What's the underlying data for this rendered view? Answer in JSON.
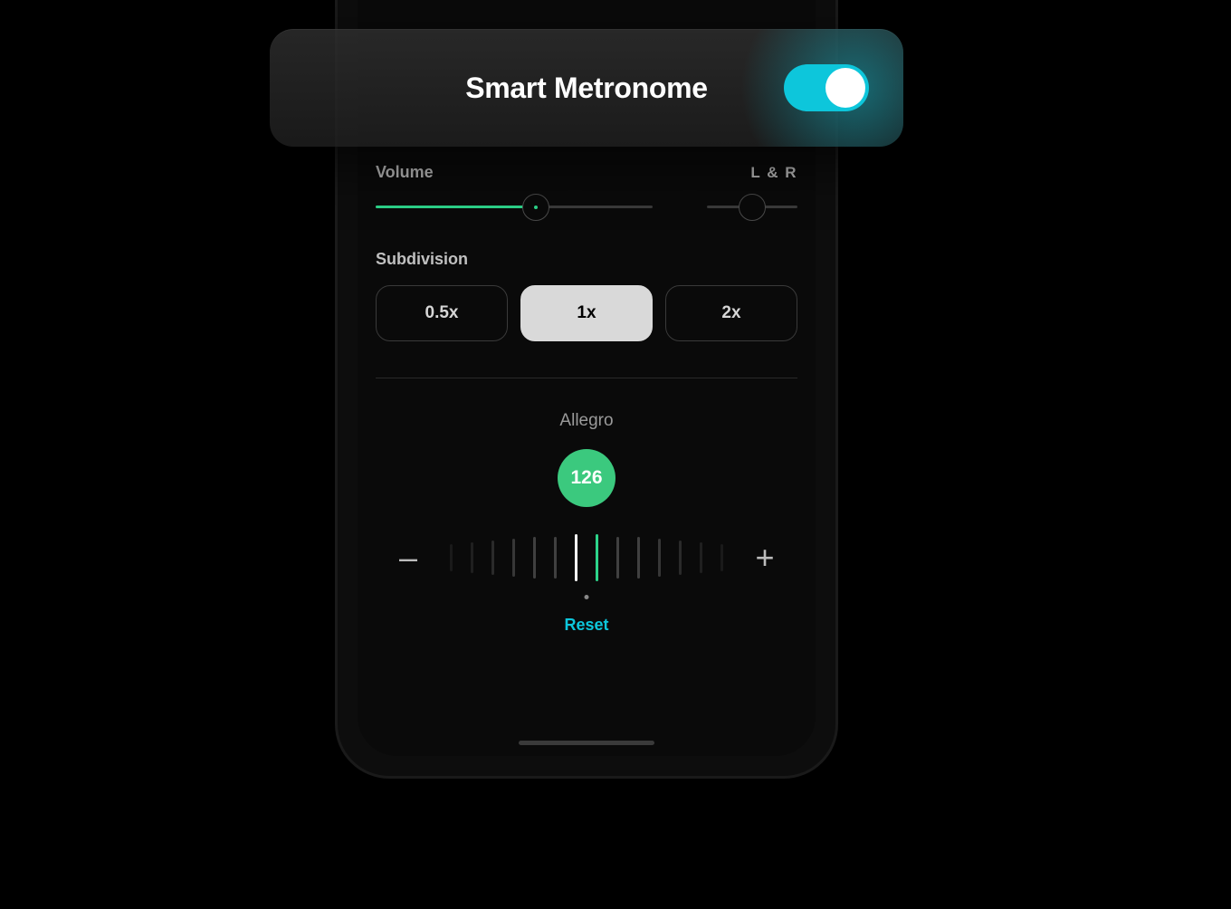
{
  "header": {
    "title": "Smart Metronome",
    "toggle_on": true
  },
  "volume": {
    "label": "Volume",
    "pan_label": "L & R",
    "percent": 58,
    "pan_percent": 50
  },
  "subdivision": {
    "label": "Subdivision",
    "options": [
      "0.5x",
      "1x",
      "2x"
    ],
    "active_index": 1
  },
  "tempo": {
    "name": "Allegro",
    "bpm": "126",
    "reset_label": "Reset",
    "minus": "–",
    "plus": "+"
  },
  "colors": {
    "accent_teal": "#0dc6db",
    "accent_green": "#2dd48a"
  }
}
